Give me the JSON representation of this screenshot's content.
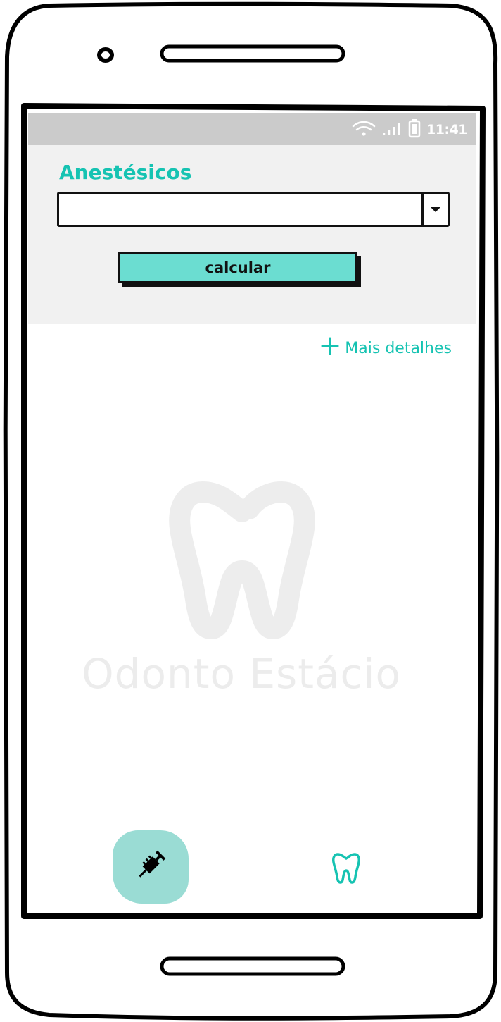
{
  "status_bar": {
    "time": "11:41",
    "icons": [
      "wifi-icon",
      "signal-icon",
      "battery-icon"
    ]
  },
  "form": {
    "title": "Anestésicos",
    "select": {
      "selected": "",
      "icon": "chevron-down-icon"
    },
    "calculate_label": "calcular"
  },
  "details_link": {
    "label": "Mais detalhes",
    "icon": "plus-icon"
  },
  "watermark": {
    "text": "Odonto Estácio",
    "icon": "tooth-icon"
  },
  "bottom_nav": {
    "items": [
      {
        "icon": "syringe-icon",
        "active": true
      },
      {
        "icon": "tooth-icon",
        "active": false
      }
    ]
  },
  "colors": {
    "accent": "#16c3b2",
    "button_fill": "#6bddd1",
    "active_nav": "#9adcd4",
    "status_bar": "#cbcbcb",
    "panel": "#f1f1f1"
  }
}
